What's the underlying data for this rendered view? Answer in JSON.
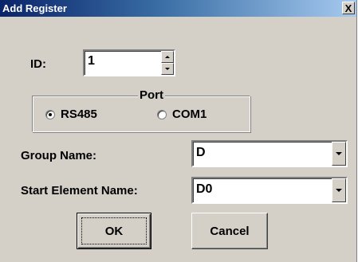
{
  "window": {
    "title": "Add Register",
    "close_glyph": "X"
  },
  "id_field": {
    "label": "ID:",
    "value": "1"
  },
  "port": {
    "title": "Port",
    "options": [
      {
        "label": "RS485",
        "selected": true
      },
      {
        "label": "COM1",
        "selected": false
      }
    ]
  },
  "group_name": {
    "label": "Group Name:",
    "value": "D"
  },
  "start_element": {
    "label": "Start Element Name:",
    "value": "D0"
  },
  "buttons": {
    "ok": "OK",
    "cancel": "Cancel"
  },
  "icons": {
    "close": "close-icon",
    "spin_up": "spin-up-icon",
    "spin_down": "spin-down-icon",
    "dropdown": "chevron-down-icon"
  },
  "colors": {
    "dialog_bg": "#d4d0c8",
    "title_start": "#0a246a",
    "title_end": "#a6caf0"
  }
}
